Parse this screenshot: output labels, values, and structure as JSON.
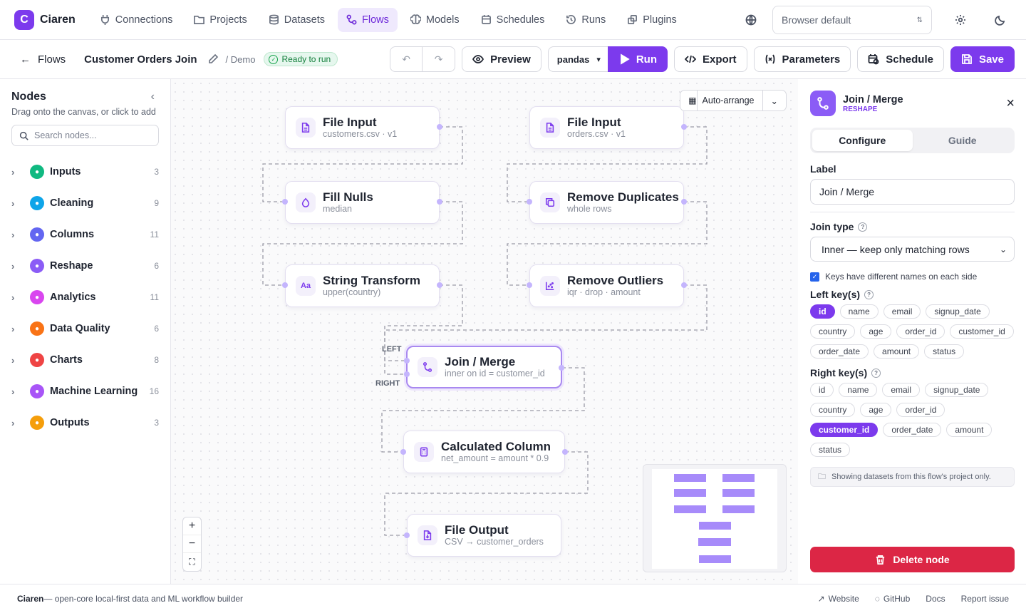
{
  "app": {
    "logo_letter": "C",
    "name": "Ciaren",
    "accent": "#7c3aed"
  },
  "nav": [
    {
      "label": "Connections",
      "icon": "plug-icon"
    },
    {
      "label": "Projects",
      "icon": "folder-icon"
    },
    {
      "label": "Datasets",
      "icon": "database-icon"
    },
    {
      "label": "Flows",
      "icon": "flow-icon",
      "active": true
    },
    {
      "label": "Models",
      "icon": "brain-icon"
    },
    {
      "label": "Schedules",
      "icon": "calendar-icon"
    },
    {
      "label": "Runs",
      "icon": "history-icon"
    },
    {
      "label": "Plugins",
      "icon": "puzzle-icon"
    }
  ],
  "locale": {
    "selected": "Browser default"
  },
  "subbar": {
    "back_label": "Flows",
    "flow_title": "Customer Orders Join",
    "project": "/ Demo",
    "status": "Ready to run",
    "preview": "Preview",
    "engine": "pandas",
    "run": "Run",
    "export": "Export",
    "parameters": "Parameters",
    "schedule": "Schedule",
    "save": "Save"
  },
  "sidebar": {
    "title": "Nodes",
    "description": "Drag onto the canvas, or click to add",
    "search_placeholder": "Search nodes...",
    "categories": [
      {
        "label": "Inputs",
        "count": "3",
        "color": "#10b981"
      },
      {
        "label": "Cleaning",
        "count": "9",
        "color": "#0ea5e9"
      },
      {
        "label": "Columns",
        "count": "11",
        "color": "#6366f1"
      },
      {
        "label": "Reshape",
        "count": "6",
        "color": "#8b5cf6"
      },
      {
        "label": "Analytics",
        "count": "11",
        "color": "#d946ef"
      },
      {
        "label": "Data Quality",
        "count": "6",
        "color": "#f97316"
      },
      {
        "label": "Charts",
        "count": "8",
        "color": "#ef4444"
      },
      {
        "label": "Machine Learning",
        "count": "16",
        "color": "#a855f7"
      },
      {
        "label": "Outputs",
        "count": "3",
        "color": "#f59e0b"
      }
    ]
  },
  "canvas": {
    "auto_arrange": "Auto-arrange",
    "port_left": "LEFT",
    "port_right": "RIGHT",
    "nodes": [
      {
        "title": "File Input",
        "sub": "customers.csv · v1",
        "icon": "file-icon"
      },
      {
        "title": "File Input",
        "sub": "orders.csv · v1",
        "icon": "file-icon"
      },
      {
        "title": "Fill Nulls",
        "sub": "median",
        "icon": "droplet-icon"
      },
      {
        "title": "Remove Duplicates",
        "sub": "whole rows",
        "icon": "copy-icon"
      },
      {
        "title": "String Transform",
        "sub": "upper(country)",
        "icon": "text-icon"
      },
      {
        "title": "Remove Outliers",
        "sub": "iqr · drop · amount",
        "icon": "scatter-icon"
      },
      {
        "title": "Join / Merge",
        "sub": "inner on id = customer_id",
        "icon": "merge-icon"
      },
      {
        "title": "Calculated Column",
        "sub": "net_amount = amount * 0.9",
        "icon": "calculator-icon"
      },
      {
        "title": "File Output",
        "sub": "CSV → customer_orders",
        "icon": "file-out-icon"
      }
    ]
  },
  "panel": {
    "title": "Join / Merge",
    "kind": "RESHAPE",
    "tab_configure": "Configure",
    "tab_guide": "Guide",
    "label_label": "Label",
    "label_value": "Join / Merge",
    "join_type_label": "Join type",
    "join_type_value": "Inner — keep only matching rows",
    "diff_names_label": "Keys have different names on each side",
    "left_keys_label": "Left key(s)",
    "right_keys_label": "Right key(s)",
    "columns": [
      "id",
      "name",
      "email",
      "signup_date",
      "country",
      "age",
      "order_id",
      "customer_id",
      "order_date",
      "amount",
      "status"
    ],
    "left_selected": "id",
    "right_selected": "customer_id",
    "note": "Showing datasets from this flow's project only.",
    "delete": "Delete node"
  },
  "footer": {
    "brand": "Ciaren",
    "tagline": " — open-core local-first data and ML workflow builder",
    "links": [
      "Website",
      "GitHub",
      "Docs",
      "Report issue"
    ]
  }
}
